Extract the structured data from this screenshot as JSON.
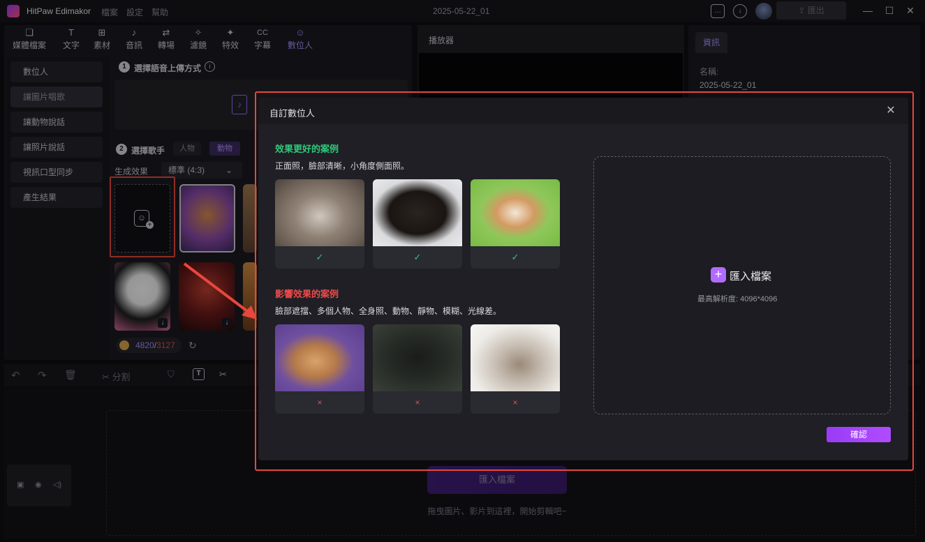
{
  "titlebar": {
    "app_name": "HitPaw Edimakor",
    "menus": [
      "檔案",
      "設定",
      "幫助"
    ],
    "project_title": "2025-05-22_01",
    "export_label": "匯出"
  },
  "tabs": [
    {
      "icon": "media-icon",
      "glyph": "❏",
      "label": "媒體檔案"
    },
    {
      "icon": "text-icon",
      "glyph": "T",
      "label": "文字"
    },
    {
      "icon": "assets-icon",
      "glyph": "⊞",
      "label": "素材"
    },
    {
      "icon": "audio-icon",
      "glyph": "♪",
      "label": "音訊"
    },
    {
      "icon": "transition-icon",
      "glyph": "⇄",
      "label": "轉場"
    },
    {
      "icon": "filter-icon",
      "glyph": "✧",
      "label": "濾鏡"
    },
    {
      "icon": "effects-icon",
      "glyph": "✦",
      "label": "特效"
    },
    {
      "icon": "subtitle-icon",
      "glyph": "CC",
      "label": "字幕"
    },
    {
      "icon": "avatar-icon",
      "glyph": "☺",
      "label": "數位人"
    }
  ],
  "categories": [
    "數位人",
    "讓圖片唱歌",
    "讓動物說話",
    "讓照片說話",
    "視訊口型同步",
    "產生結果"
  ],
  "active_category": "讓圖片唱歌",
  "steps": {
    "step1_num": "1",
    "step1_label": "選擇語音上傳方式",
    "step2_num": "2",
    "step2_label": "選擇歌手",
    "singer_people": "人物",
    "singer_animals": "動物",
    "effect_label": "生成效果",
    "ratio_value": "標準 (4:3)"
  },
  "coins": {
    "current": "4820",
    "total": "3127",
    "separator": "/"
  },
  "player": {
    "header": "播放器"
  },
  "info": {
    "tab": "資訊",
    "name_label": "名稱:",
    "name_value": "2025-05-22_01"
  },
  "timeline": {
    "split_label": "分割",
    "import_label": "匯入檔案",
    "drop_hint": "拖曳圖片、影片到這裡，開始剪輯吧~"
  },
  "dialog": {
    "title": "自訂數位人",
    "good_title": "效果更好的案例",
    "good_desc": "正面照，臉部清晰，小角度側面照。",
    "bad_title": "影響效果的案例",
    "bad_desc": "臉部遮擋、多個人物、全身照、動物、靜物、模糊、光線差。",
    "good_mark": "✓",
    "bad_mark": "×",
    "upload_label": "匯入檔案",
    "upload_hint": "最高解析度: 4096*4096",
    "confirm_label": "確認"
  },
  "colors": {
    "accent": "#a78bff",
    "good": "#2fc97a",
    "bad": "#ef4b4b",
    "highlight_box": "#e8473d",
    "confirm": "#a847ff"
  }
}
